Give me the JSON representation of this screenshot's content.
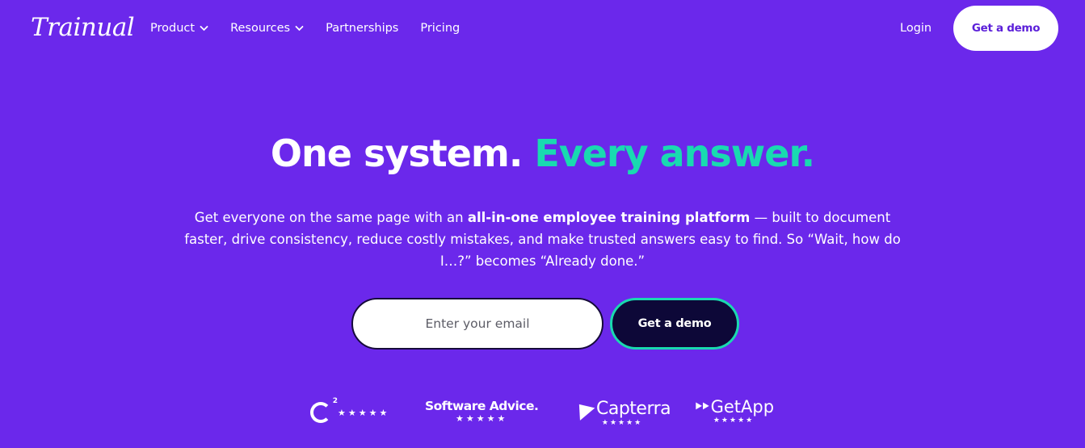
{
  "header": {
    "logo": "Trainual",
    "nav": [
      {
        "label": "Product",
        "has_dropdown": true
      },
      {
        "label": "Resources",
        "has_dropdown": true
      },
      {
        "label": "Partnerships",
        "has_dropdown": false
      },
      {
        "label": "Pricing",
        "has_dropdown": false
      }
    ],
    "login_label": "Login",
    "cta_label": "Get a demo"
  },
  "hero": {
    "headline_part1": "One system.",
    "headline_part2": "Every answer.",
    "sub_before": "Get everyone on the same page with an ",
    "sub_bold": "all-in-one employee training platform",
    "sub_after": " — built to document faster, drive consistency, reduce costly mistakes, and make trusted answers easy to find. So “Wait, how do I…?” becomes “Already done.”",
    "email_placeholder": "Enter your email",
    "email_value": "",
    "cta_label": "Get a demo"
  },
  "badges": [
    {
      "name": "G2",
      "rating_stars": "★★★★★",
      "icon": "g2-icon"
    },
    {
      "name": "Software Advice.",
      "rating_stars": "★★★★★",
      "icon": "software-advice-icon"
    },
    {
      "name": "Capterra",
      "rating_stars": "★★★★★",
      "icon": "capterra-icon"
    },
    {
      "name": "GetApp",
      "rating_stars": "★★★★★",
      "icon": "getapp-icon"
    }
  ],
  "colors": {
    "background": "#6b28eb",
    "accent": "#19dab0",
    "dark_button": "#0d0838",
    "brand_text": "#5b1fd9"
  }
}
